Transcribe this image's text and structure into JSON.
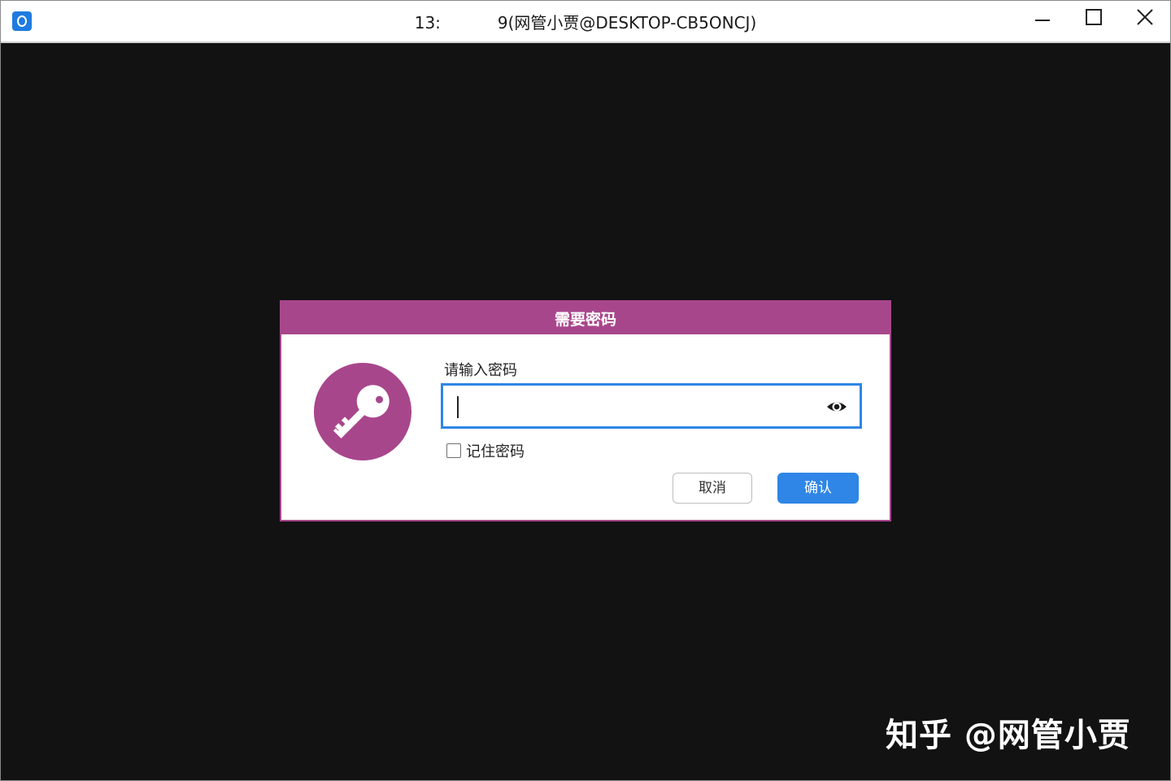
{
  "window": {
    "title": "13:           9(网管小贾@DESKTOP-CB5ONCJ)",
    "icon": "app-logo-icon"
  },
  "dialog": {
    "title": "需要密码",
    "icon": "key-icon",
    "password_label": "请输入密码",
    "password_value": "",
    "remember_label": "记住密码",
    "remember_checked": false,
    "cancel_label": "取消",
    "confirm_label": "确认"
  },
  "watermark": "知乎 @网管小贾",
  "colors": {
    "accent": "#a8468c",
    "primary_button": "#2f86e6",
    "background": "#121212"
  }
}
